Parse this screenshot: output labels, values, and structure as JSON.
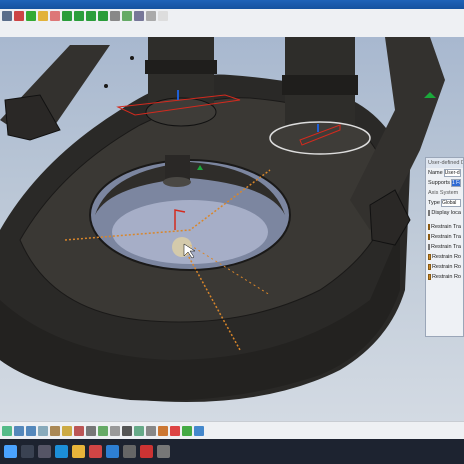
{
  "colors": {
    "titlebar": "#1f63b8",
    "model_body": "#2b2a28",
    "constraint_red": "#d42a1e",
    "constraint_orange": "#d9862a",
    "axis_green": "#1aa83a",
    "axis_blue": "#1f5fd6",
    "viewport_bg": "#b4c3d5"
  },
  "toolbar": {
    "icons": [
      "cursor-icon",
      "select-icon",
      "hand-icon",
      "info-icon",
      "add-icon",
      "pan-icon",
      "rotate-icon",
      "zoom-icon",
      "fit-icon",
      "grid-icon",
      "hidden-icon",
      "normal-view-icon",
      "layers-icon",
      "color-icon"
    ]
  },
  "panel": {
    "title": "User-defined D",
    "name_label": "Name",
    "name_value": "User-d",
    "supports_label": "Supports",
    "supports_value": "1 Fa",
    "axis_system_label": "Axis System",
    "type_label": "Type",
    "type_value": "Global",
    "display_label": "Display loca",
    "restraints": [
      {
        "label": "Restrain Tra",
        "checked": true
      },
      {
        "label": "Restrain Tra",
        "checked": true
      },
      {
        "label": "Restrain Tra",
        "checked": false
      },
      {
        "label": "Restrain Ro",
        "checked": true
      },
      {
        "label": "Restrain Ro",
        "checked": true
      },
      {
        "label": "Restrain Ro",
        "checked": true
      }
    ]
  },
  "cmdbar": {
    "icons": [
      "view-icon",
      "zoom-in-icon",
      "zoom-out-icon",
      "rotate-icon",
      "normal-icon",
      "iso-icon",
      "render-icon",
      "hide-icon",
      "swap-icon",
      "measure-icon",
      "section-icon",
      "analysis-icon",
      "mesh-icon",
      "restraint-icon",
      "load-icon",
      "compute-icon",
      "results-icon"
    ]
  },
  "taskbar": {
    "icons": [
      "start-icon",
      "search-icon",
      "task-view-icon",
      "edge-icon",
      "explorer-icon",
      "chrome-icon",
      "mail-icon",
      "store-icon",
      "catia-icon",
      "media-icon"
    ]
  }
}
